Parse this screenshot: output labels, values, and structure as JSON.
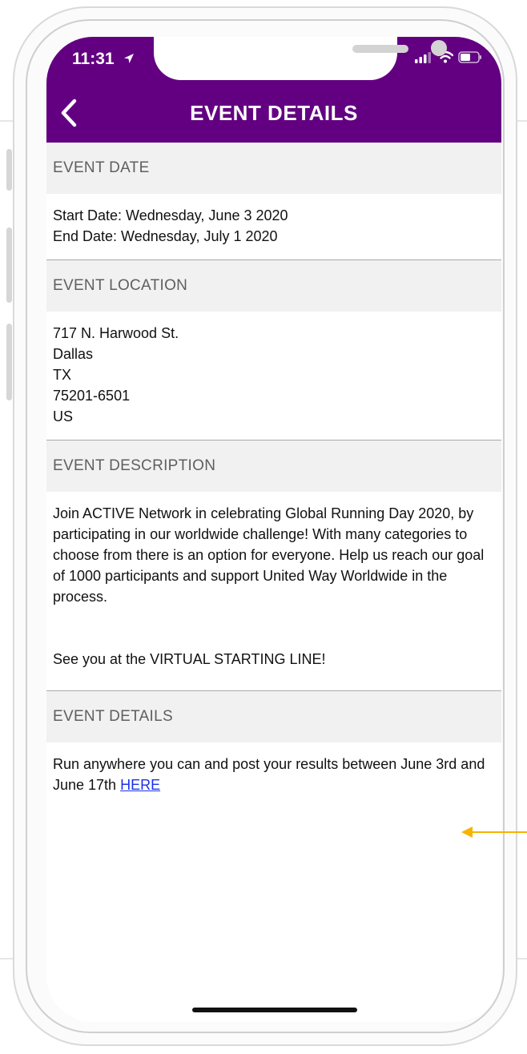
{
  "status_bar": {
    "time": "11:31"
  },
  "header": {
    "title": "EVENT DETAILS"
  },
  "sections": {
    "date": {
      "title": "EVENT DATE",
      "lines": [
        "Start Date: Wednesday, June 3 2020",
        "End Date: Wednesday, July 1 2020"
      ]
    },
    "location": {
      "title": "EVENT LOCATION",
      "lines": [
        "717 N. Harwood St.",
        "Dallas",
        "TX",
        "75201-6501",
        "US"
      ]
    },
    "description": {
      "title": "EVENT DESCRIPTION",
      "paragraph1": "Join ACTIVE Network in celebrating Global Running Day 2020, by participating in our worldwide challenge! With many categories to choose from there is an option for everyone. Help us reach our goal of 1000 participants and support United Way Worldwide in the process.",
      "paragraph2": "See you at the VIRTUAL STARTING LINE!"
    },
    "details": {
      "title": "EVENT DETAILS",
      "text": "Run anywhere you can and post your results between June 3rd and June 17th",
      "link_label": "HERE"
    }
  },
  "colors": {
    "brand": "#630082",
    "section_bg": "#f1f1f1",
    "link": "#1a32e6",
    "annotation": "#f5b400"
  },
  "icons": {
    "back": "chevron-left-icon",
    "location_arrow": "location-arrow-icon",
    "signal": "signal-icon",
    "wifi": "wifi-icon",
    "battery": "battery-icon",
    "annotation": "arrow-left-icon"
  }
}
